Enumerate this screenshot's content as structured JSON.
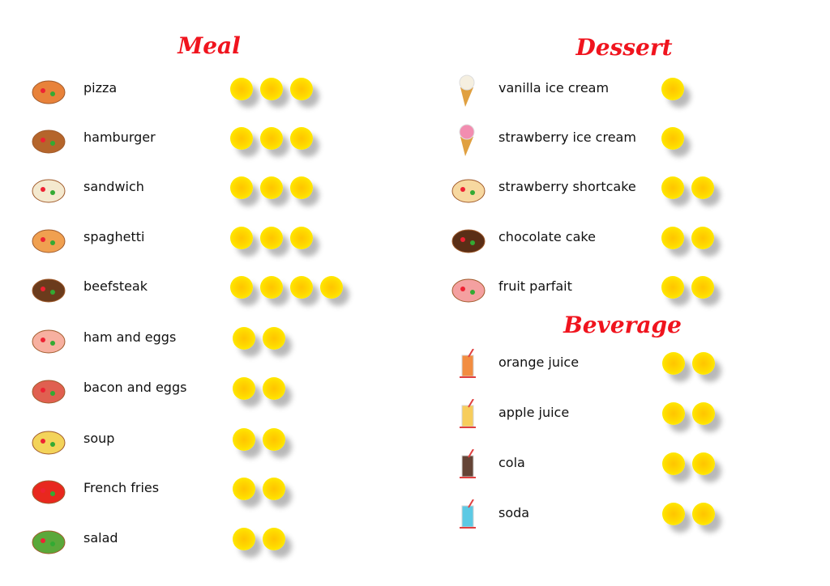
{
  "sections": {
    "meal": {
      "title": "Meal",
      "items": [
        {
          "name": "pizza",
          "coins": 3,
          "icon": "pizza-icon",
          "color": "#e8823a"
        },
        {
          "name": "hamburger",
          "coins": 3,
          "icon": "hamburger-icon",
          "color": "#b5652b"
        },
        {
          "name": "sandwich",
          "coins": 3,
          "icon": "sandwich-icon",
          "color": "#f4e9cf"
        },
        {
          "name": "spaghetti",
          "coins": 3,
          "icon": "spaghetti-icon",
          "color": "#f0a050"
        },
        {
          "name": "beefsteak",
          "coins": 4,
          "icon": "beefsteak-icon",
          "color": "#6b3b1c"
        },
        {
          "name": "ham and eggs",
          "coins": 2,
          "icon": "ham-and-eggs-icon",
          "color": "#f7b0a0"
        },
        {
          "name": "bacon and eggs",
          "coins": 2,
          "icon": "bacon-and-eggs-icon",
          "color": "#e06050"
        },
        {
          "name": "soup",
          "coins": 2,
          "icon": "soup-icon",
          "color": "#f3d35a"
        },
        {
          "name": "French fries",
          "coins": 2,
          "icon": "french-fries-icon",
          "color": "#e8281e"
        },
        {
          "name": "salad",
          "coins": 2,
          "icon": "salad-icon",
          "color": "#5aa83a"
        }
      ]
    },
    "dessert": {
      "title": "Dessert",
      "items": [
        {
          "name": "vanilla ice cream",
          "coins": 1,
          "icon": "vanilla-ice-cream-icon",
          "color": "#f5efe0"
        },
        {
          "name": "strawberry ice cream",
          "coins": 1,
          "icon": "strawberry-ice-cream-icon",
          "color": "#f28db0"
        },
        {
          "name": "strawberry shortcake",
          "coins": 2,
          "icon": "strawberry-shortcake-icon",
          "color": "#f7d8a0"
        },
        {
          "name": "chocolate cake",
          "coins": 2,
          "icon": "chocolate-cake-icon",
          "color": "#5a2e16"
        },
        {
          "name": "fruit parfait",
          "coins": 2,
          "icon": "fruit-parfait-icon",
          "color": "#f4a0a0"
        }
      ]
    },
    "beverage": {
      "title": "Beverage",
      "items": [
        {
          "name": "orange juice",
          "coins": 2,
          "icon": "orange-juice-icon",
          "color": "#f07a20"
        },
        {
          "name": "apple juice",
          "coins": 2,
          "icon": "apple-juice-icon",
          "color": "#f6c540"
        },
        {
          "name": "cola",
          "coins": 2,
          "icon": "cola-icon",
          "color": "#4a2414"
        },
        {
          "name": "soda",
          "coins": 2,
          "icon": "soda-icon",
          "color": "#40c0e0"
        }
      ]
    }
  }
}
